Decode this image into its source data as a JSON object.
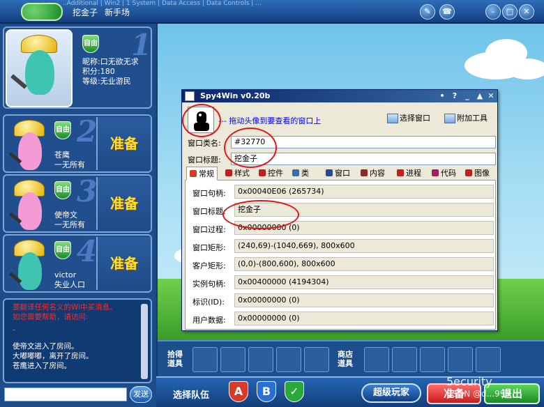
{
  "game": {
    "title": "挖金子",
    "mode": "新手场",
    "behind_text": "..Additional | Win2 | 1 System | Data Access | Data Controls | ..."
  },
  "players": [
    {
      "status": "自由",
      "rank_label": "1",
      "nickname_label": "昵称:",
      "nickname": "口无欲无求",
      "score_label": "积分:",
      "score": "180",
      "level_label": "等级:",
      "level": "无业游民"
    },
    {
      "status": "自由",
      "rank_label": "2",
      "name": "苍鹰",
      "level": "一无所有",
      "ready": "准备"
    },
    {
      "status": "自由",
      "rank_label": "3",
      "name": "使帝文",
      "level": "一无所有",
      "ready": "准备"
    },
    {
      "status": "自由",
      "rank_label": "4",
      "name": "victor",
      "level": "失业人口",
      "ready": "准备"
    }
  ],
  "chat": {
    "lines": [
      {
        "text": "要翻译任何名义的Wi中买消息。",
        "style": "red"
      },
      {
        "text": "如您需要帮助，请访问:",
        "style": "red"
      },
      {
        "text": "使帝文进入了房间。",
        "style": "wht"
      },
      {
        "text": "大嘟嘟嘟，离开了房间。",
        "style": "wht"
      },
      {
        "text": "苍鹰进入了房间。",
        "style": "wht"
      }
    ],
    "send_label": "发送"
  },
  "items": {
    "game_items_label": "拾得道具",
    "shop_items_label": "商店道具"
  },
  "bottom": {
    "team_label": "选择队伍",
    "team_a": "A",
    "team_b": "B",
    "team_c": "✓",
    "super_player": "超级玩家",
    "ready": "准备",
    "exit": "退出"
  },
  "watermark": {
    "line1": "5ecurity",
    "line2": "CSDN @d...998"
  },
  "spy": {
    "title": "Spy4Win v0.20b",
    "controls": [
      "•",
      "?",
      "_",
      "▲",
      "✕"
    ],
    "hint": "--- 拖动头像到要查看的窗口上",
    "select_window": "选择窗口",
    "attach_tool": "附加工具",
    "class_label": "窗口类名:",
    "class_value": "#32770",
    "title_label": "窗口标题:",
    "title_value": "挖金子",
    "tabs": [
      {
        "label": "常规",
        "color": "#d04020"
      },
      {
        "label": "样式",
        "color": "#c02020"
      },
      {
        "label": "控件",
        "color": "#c02020"
      },
      {
        "label": "类",
        "color": "#3a6ea5"
      },
      {
        "label": "窗口",
        "color": "#2a4a8a"
      },
      {
        "label": "内容",
        "color": "#8a2a2a"
      },
      {
        "label": "进程",
        "color": "#c02020"
      },
      {
        "label": "代码",
        "color": "#a02060"
      },
      {
        "label": "图像",
        "color": "#c02020"
      }
    ],
    "rows": [
      {
        "label": "窗口句柄:",
        "value": "0x00040E06 (265734)"
      },
      {
        "label": "窗口标题:",
        "value": "挖金子"
      },
      {
        "label": "窗口过程:",
        "value": "0x00000000 (0)"
      },
      {
        "label": "窗口矩形:",
        "value": "(240,69)-(1040,669), 800x600"
      },
      {
        "label": "客户矩形:",
        "value": "(0,0)-(800,600), 800x600"
      },
      {
        "label": "实例句柄:",
        "value": "0x00400000 (4194304)"
      },
      {
        "label": "标识(ID):",
        "value": "0x00000000 (0)"
      },
      {
        "label": "用户数据:",
        "value": "0x00000000 (0)"
      }
    ]
  }
}
